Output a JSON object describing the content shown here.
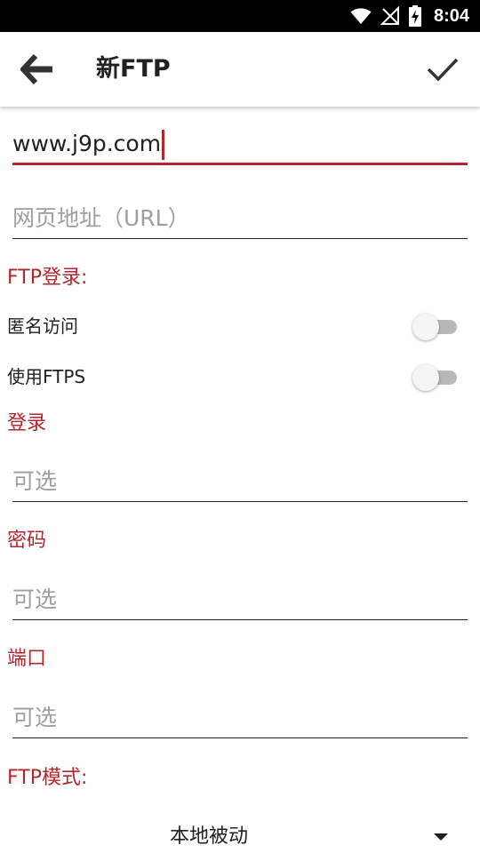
{
  "status_bar": {
    "time": "8:04",
    "icons": [
      "wifi-icon",
      "no-signal-icon",
      "battery-charging-icon"
    ]
  },
  "toolbar": {
    "title": "新FTP",
    "back_icon": "arrow-left-icon",
    "confirm_icon": "checkmark-icon"
  },
  "form": {
    "host": {
      "value": "www.j9p.com"
    },
    "url": {
      "placeholder": "网页地址（URL）"
    },
    "ftp_login_section": "FTP登录:",
    "anonymous": {
      "label": "匿名访问",
      "on": false
    },
    "ftps": {
      "label": "使用FTPS",
      "on": false
    },
    "login": {
      "label": "登录",
      "placeholder": "可选"
    },
    "password": {
      "label": "密码",
      "placeholder": "可选"
    },
    "port": {
      "label": "端口",
      "placeholder": "可选"
    },
    "ftp_mode_section": "FTP模式:",
    "ftp_mode": {
      "selected": "本地被动"
    }
  },
  "colors": {
    "accent": "#b3262b",
    "status_bar": "#000000",
    "hint": "#9e9e9e"
  }
}
